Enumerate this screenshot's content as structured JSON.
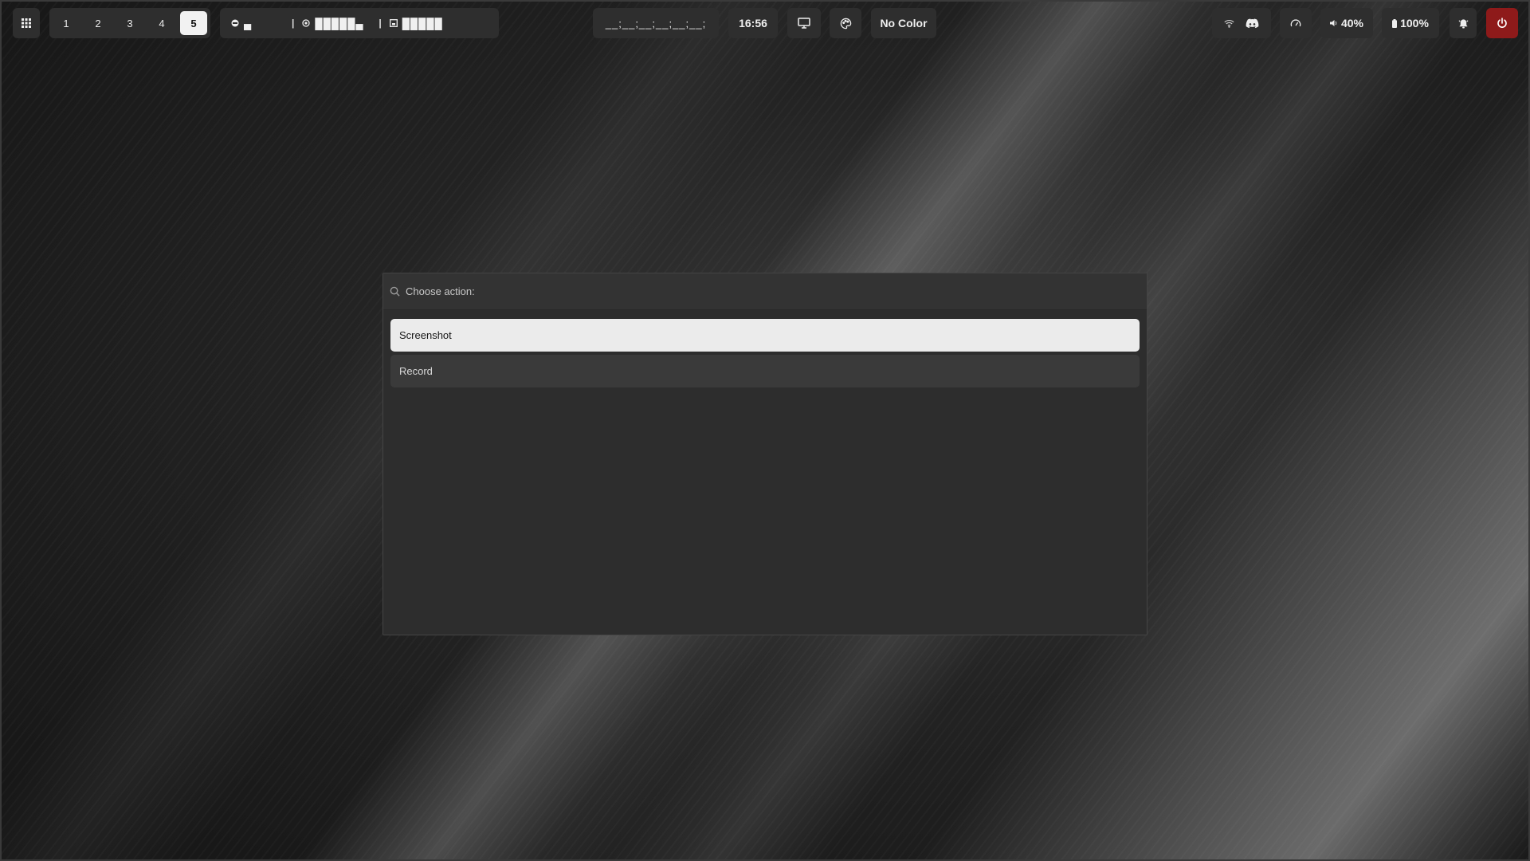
{
  "colors": {
    "bar_bg": "#2e2e2e",
    "active_workspace_bg": "#f2f2f2",
    "power_bg": "#8e1a1a",
    "dialog_bg": "#2d2d2d",
    "selected_item_bg": "#ebebeb"
  },
  "topbar": {
    "launcher_icon": "grid-icon",
    "workspaces": [
      "1",
      "2",
      "3",
      "4",
      "5"
    ],
    "active_workspace": "5",
    "sysmon": {
      "cpu_bar": "▄",
      "separator": "|",
      "mem_bar": "█████▄",
      "disk_bar": "█████"
    },
    "media_text": "__;__;__;__;__;__;",
    "clock": "16:56",
    "display_icon": "monitor-icon",
    "palette_icon": "palette-icon",
    "color_picker_label": "No Color",
    "wifi_icon": "wifi-icon",
    "discord_icon": "discord-icon",
    "performance_icon": "speedometer-icon",
    "volume": "40%",
    "battery": "100%",
    "notification_icon": "bell-icon",
    "power_icon": "power-icon"
  },
  "dialog": {
    "placeholder": "Choose action:",
    "options": [
      "Screenshot",
      "Record"
    ],
    "selected_option": "Screenshot"
  }
}
